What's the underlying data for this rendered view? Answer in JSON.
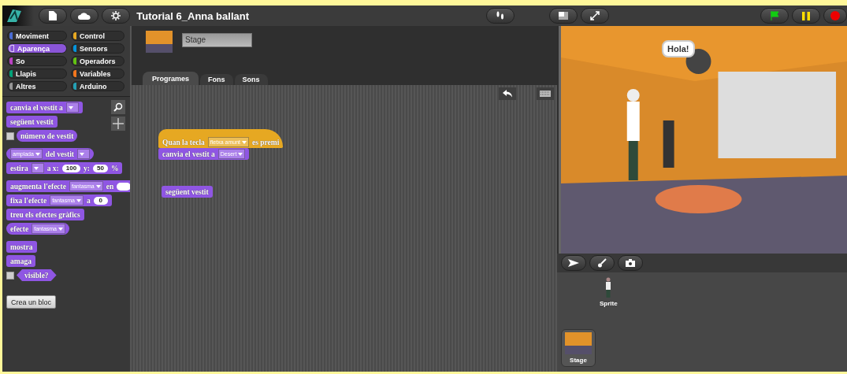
{
  "project": {
    "title": "Tutorial 6_Anna ballant"
  },
  "categories": [
    {
      "label": "Moviment",
      "color": "#4a6cd4",
      "selected": false
    },
    {
      "label": "Control",
      "color": "#e6a822",
      "selected": false
    },
    {
      "label": "Aparença",
      "color": "#8a55d7",
      "selected": true
    },
    {
      "label": "Sensors",
      "color": "#0494dc",
      "selected": false
    },
    {
      "label": "So",
      "color": "#bb42c3",
      "selected": false
    },
    {
      "label": "Operadors",
      "color": "#62c213",
      "selected": false
    },
    {
      "label": "Llapis",
      "color": "#00a178",
      "selected": false
    },
    {
      "label": "Variables",
      "color": "#f3761d",
      "selected": false
    },
    {
      "label": "Altres",
      "color": "#969696",
      "selected": false
    },
    {
      "label": "Arduino",
      "color": "#24a0b4",
      "selected": false
    }
  ],
  "palette_groups": [
    [
      {
        "kind": "command",
        "parts": [
          {
            "kind": "label",
            "text": "canvia el vestit a"
          },
          {
            "kind": "dropdown"
          }
        ]
      },
      {
        "kind": "command",
        "parts": [
          {
            "kind": "label",
            "text": "següent vestit"
          }
        ]
      },
      {
        "kind": "reporter",
        "checkbox": {
          "checked": false
        },
        "parts": [
          {
            "kind": "label",
            "text": "número de vestit"
          }
        ]
      }
    ],
    [
      {
        "kind": "reporter",
        "parts": [
          {
            "kind": "dropdown",
            "text": "amplada"
          },
          {
            "kind": "label",
            "text": "del vestit"
          },
          {
            "kind": "dropdown"
          }
        ]
      },
      {
        "kind": "command",
        "parts": [
          {
            "kind": "label",
            "text": "estira"
          },
          {
            "kind": "dropdown"
          },
          {
            "kind": "label",
            "text": "a x:"
          },
          {
            "kind": "number",
            "text": "100"
          },
          {
            "kind": "label",
            "text": "y:"
          },
          {
            "kind": "number",
            "text": "50"
          },
          {
            "kind": "label",
            "text": "%"
          }
        ]
      }
    ],
    [
      {
        "kind": "command",
        "parts": [
          {
            "kind": "label",
            "text": "augmenta l'efecte"
          },
          {
            "kind": "dropdown",
            "text": "fantasma"
          },
          {
            "kind": "label",
            "text": "en"
          },
          {
            "kind": "number"
          }
        ]
      },
      {
        "kind": "command",
        "parts": [
          {
            "kind": "label",
            "text": "fixa l'efecte"
          },
          {
            "kind": "dropdown",
            "text": "fantasma"
          },
          {
            "kind": "label",
            "text": "a"
          },
          {
            "kind": "number",
            "text": "0"
          }
        ]
      },
      {
        "kind": "command",
        "parts": [
          {
            "kind": "label",
            "text": "treu els efectes gràfics"
          }
        ]
      },
      {
        "kind": "reporter",
        "parts": [
          {
            "kind": "label",
            "text": "efecte"
          },
          {
            "kind": "dropdown",
            "text": "fantasma"
          }
        ]
      }
    ],
    [
      {
        "kind": "command",
        "parts": [
          {
            "kind": "label",
            "text": "mostra"
          }
        ]
      },
      {
        "kind": "command",
        "parts": [
          {
            "kind": "label",
            "text": "amaga"
          }
        ]
      },
      {
        "kind": "predicate",
        "checkbox": {
          "checked": false
        },
        "parts": [
          {
            "kind": "label",
            "text": "visible?"
          }
        ]
      }
    ]
  ],
  "make_block_button": "Crea un bloc",
  "sprite_name": "Stage",
  "tabs": [
    {
      "label": "Programes",
      "selected": true
    },
    {
      "label": "Fons",
      "selected": false
    },
    {
      "label": "Sons",
      "selected": false
    }
  ],
  "scripts": [
    {
      "blocks": [
        {
          "kind": "hat",
          "color": "#e6a822",
          "parts": [
            {
              "kind": "label",
              "text": "Quan la tecla"
            },
            {
              "kind": "dropdown",
              "text": "fletxa amunt"
            },
            {
              "kind": "label",
              "text": "es premi"
            }
          ]
        },
        {
          "kind": "command",
          "color": "#8f56e3",
          "parts": [
            {
              "kind": "label",
              "text": "canvia el vestit a"
            },
            {
              "kind": "dropdown",
              "text": "Desert"
            }
          ]
        }
      ]
    },
    {
      "blocks": [
        {
          "kind": "command",
          "color": "#8f56e3",
          "parts": [
            {
              "kind": "label",
              "text": "següent vestit"
            }
          ]
        }
      ]
    }
  ],
  "stage": {
    "speech": "Hola!"
  },
  "corral": {
    "sprites": [
      {
        "name": "Sprite"
      }
    ],
    "stage_label": "Stage"
  }
}
